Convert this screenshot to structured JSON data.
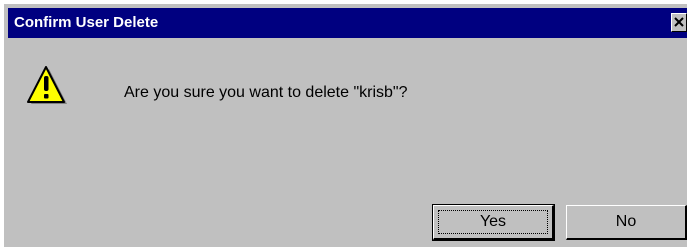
{
  "dialog": {
    "title": "Confirm User Delete",
    "message": "Are you sure you want to delete \"krisb\"?",
    "icon": "warning-icon",
    "buttons": {
      "yes_label": "Yes",
      "no_label": "No"
    }
  },
  "colors": {
    "titlebar": "#000080",
    "dialog_bg": "#c0c0c0",
    "warning_yellow": "#ffff00"
  }
}
